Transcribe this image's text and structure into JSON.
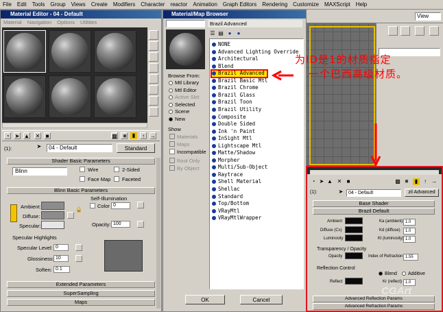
{
  "app_menu": [
    "File",
    "Edit",
    "Tools",
    "Group",
    "Views",
    "Create",
    "Modifiers",
    "Character",
    "reactor",
    "Animation",
    "Graph Editors",
    "Rendering",
    "Customize",
    "MAXScript",
    "Help"
  ],
  "material_editor": {
    "title": "Material Editor - 04 - Default",
    "menu": [
      "Material",
      "Navigation",
      "Options",
      "Utilities"
    ],
    "material_name": "04 - Default",
    "material_type": "Standard",
    "material_index": "(1):",
    "shader_rollout": "Shader Basic Parameters",
    "shader_type": "Blinn",
    "shader_checks": [
      "Wire",
      "2-Sided",
      "Face Map",
      "Faceted"
    ],
    "blinn_rollout": "Blinn Basic Parameters",
    "self_illum_label": "Self-Illumination",
    "color_check_label": "Color",
    "self_illum_value": "0",
    "ambient_label": "Ambient:",
    "diffuse_label": "Diffuse:",
    "specular_label": "Specular:",
    "opacity_label": "Opacity:",
    "opacity_value": "100",
    "spec_highlights_label": "Specular Highlights",
    "spec_level_label": "Specular Level:",
    "spec_level_value": "0",
    "glossiness_label": "Glossiness:",
    "glossiness_value": "10",
    "soften_label": "Soften:",
    "soften_value": "0.1",
    "extended_rollout": "Extended Parameters",
    "supersampling_rollout": "SuperSampling",
    "maps_rollout": "Maps"
  },
  "browser": {
    "title": "Material/Map Browser",
    "current_type": "Brazil Advanced",
    "browse_from_label": "Browse From:",
    "browse_from": [
      "Mtl Library",
      "Mtl Editor",
      "Active Slot",
      "Selected",
      "Scene",
      "New"
    ],
    "show_label": "Show",
    "show_items": [
      "Materials",
      "Maps",
      "Incompatible"
    ],
    "root_label": "Root Only",
    "by_label": "By Object",
    "items": [
      "NONE",
      "Advanced Lighting Override",
      "Architectural",
      "Blend",
      "Brazil Advanced",
      "Brazil Basic Mtl",
      "Brazil Chrome",
      "Brazil Glass",
      "Brazil Toon",
      "Brazil Utility",
      "Composite",
      "Double Sided",
      "Ink 'n Paint",
      "InSight Mtl",
      "Lightscape Mtl",
      "Matte/Shadow",
      "Morpher",
      "Multi/Sub-Object",
      "Raytrace",
      "Shell Material",
      "Shellac",
      "Standard",
      "Top/Bottom",
      "VRayMtl",
      "VRayMtlWrapper"
    ],
    "ok_label": "OK",
    "cancel_label": "Cancel"
  },
  "annotation": {
    "line1": "为ID是1的材质指定",
    "line2": "一个巴西高级材质。",
    "color": "#ff0000"
  },
  "viewport": {
    "view_label": "View"
  },
  "brazil_panel": {
    "material_name": "04 - Default",
    "type_label": "zil Advanced",
    "index": "(1):",
    "base_shader": "Base Shader",
    "brazil_default": "Brazil Default",
    "ambient_label": "Ambient",
    "diffuse_label": "Diffuse (Cs)",
    "luminosity_label": "Luminosity",
    "ka_label": "Ka (ambient)",
    "ka_value": "1.0",
    "kd_label": "Kd (diffuse)",
    "kd_value": "1.0",
    "kl_label": "Kl (luminosity)",
    "kl_value": "1.0",
    "transparency_label": "Transparency / Opacity",
    "opacity_label": "Opacity",
    "ior_label": "Index of Refraction",
    "ior_value": "1.55",
    "reflection_label": "Reflection Control",
    "blend_label": "Blend",
    "additive_label": "Additive",
    "reflect_label": "Reflect",
    "kr_label": "Kr (reflect)",
    "kr_value": "1.0",
    "adv_refraction": "Advanced Reflection Params",
    "adv_refraction2": "Advanced Refraction Params"
  },
  "watermark": "CGArt"
}
